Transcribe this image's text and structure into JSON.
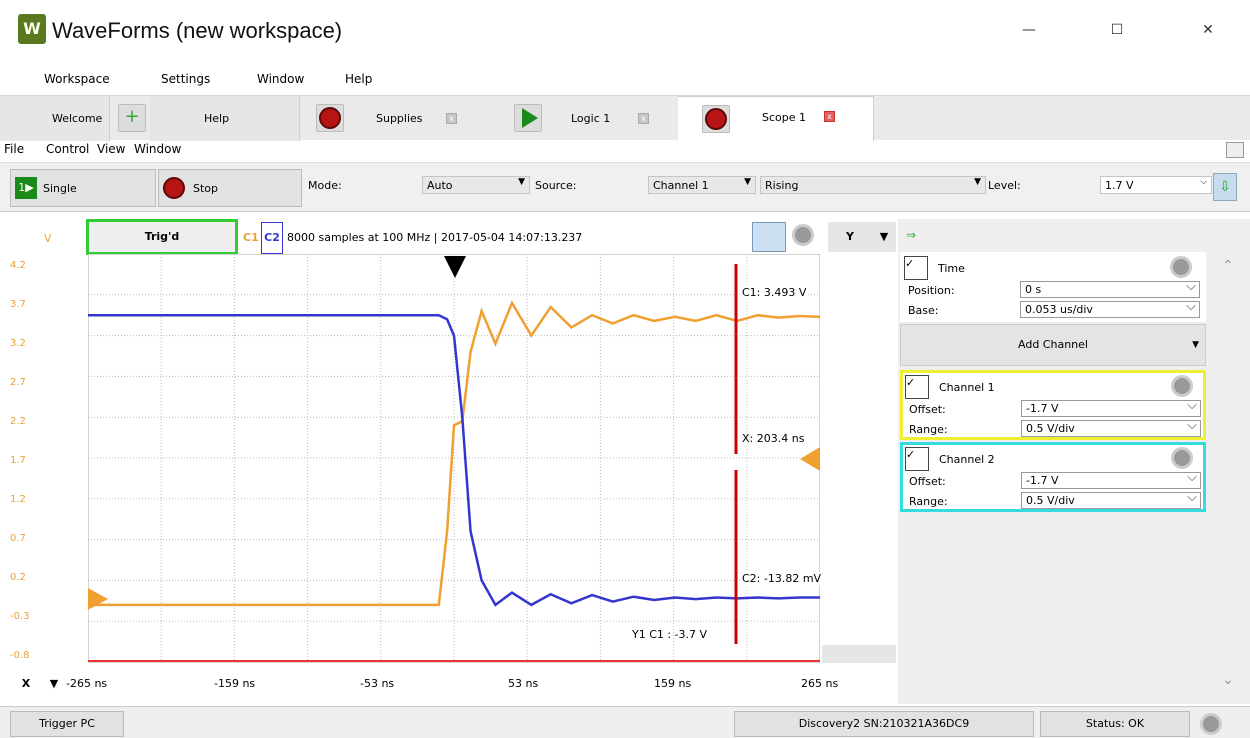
{
  "app": {
    "title": "WaveForms  (new workspace)"
  },
  "window_controls": {
    "minimize": "—",
    "maximize": "☐",
    "close": "✕"
  },
  "menu_main": [
    "Workspace",
    "Settings",
    "Window",
    "Help"
  ],
  "tabs": {
    "welcome": "Welcome",
    "help": "Help",
    "supplies": "Supplies",
    "logic": "Logic 1",
    "scope": "Scope 1"
  },
  "menu_scope": [
    "File",
    "Control",
    "View",
    "Window"
  ],
  "controls": {
    "single": "Single",
    "stop": "Stop",
    "mode_label": "Mode:",
    "mode_value": "Auto",
    "source_label": "Source:",
    "source_value": "Channel 1",
    "edge_value": "Rising",
    "level_label": "Level:",
    "level_value": "1.7 V"
  },
  "plot": {
    "v_label": "V",
    "trig_status": "Trig'd",
    "c1": "C1",
    "c2": "C2",
    "info": "8000 samples at 100 MHz | 2017-05-04 14:07:13.237",
    "y_button": "Y",
    "x_button": "X",
    "cursor_c1": "C1: 3.493 V",
    "cursor_x": "X: 203.4 ns",
    "cursor_c2": "C2: -13.82 mV",
    "y1_label": "Y1 C1 : -3.7 V",
    "y_ticks": [
      "4.2",
      "3.7",
      "3.2",
      "2.7",
      "2.2",
      "1.7",
      "1.2",
      "0.7",
      "0.2",
      "-0.3",
      "-0.8"
    ],
    "x_ticks": [
      "-265 ns",
      "-159 ns",
      "-53 ns",
      "53 ns",
      "159 ns",
      "265 ns"
    ]
  },
  "chart_data": {
    "type": "line",
    "x": [
      -265,
      -80,
      -11,
      -5,
      0,
      6,
      12,
      20,
      30,
      42,
      56,
      70,
      85,
      100,
      115,
      130,
      145,
      160,
      175,
      190,
      205,
      220,
      235,
      250,
      265
    ],
    "series": [
      {
        "name": "C1",
        "color": "#f0a030",
        "values": [
          -0.1,
          -0.1,
          -0.1,
          0.8,
          2.1,
          2.15,
          3.0,
          3.5,
          3.1,
          3.6,
          3.2,
          3.55,
          3.3,
          3.45,
          3.35,
          3.45,
          3.38,
          3.43,
          3.38,
          3.45,
          3.38,
          3.45,
          3.42,
          3.44,
          3.43
        ]
      },
      {
        "name": "C2",
        "color": "#3535d0",
        "values": [
          3.45,
          3.45,
          3.45,
          3.4,
          3.2,
          2.2,
          0.8,
          0.2,
          -0.1,
          0.05,
          -0.1,
          0.03,
          -0.08,
          0.02,
          -0.06,
          0.0,
          -0.04,
          -0.01,
          -0.03,
          -0.01,
          -0.02,
          -0.01,
          -0.02,
          -0.01,
          -0.01
        ]
      }
    ],
    "ylim": [
      -0.8,
      4.2
    ],
    "xlim": [
      -265,
      265
    ],
    "grid": true
  },
  "right_panel": {
    "time": "Time",
    "position_label": "Position:",
    "position_value": "0 s",
    "base_label": "Base:",
    "base_value": "0.053 us/div",
    "add_channel": "Add Channel",
    "ch1": "Channel 1",
    "ch2": "Channel 2",
    "offset_label": "Offset:",
    "range_label": "Range:",
    "ch1_offset": "-1.7 V",
    "ch1_range": "0.5 V/div",
    "ch2_offset": "-1.7 V",
    "ch2_range": "0.5 V/div"
  },
  "status": {
    "trigger_pc": "Trigger PC",
    "device": "Discovery2 SN:210321A36DC9",
    "status": "Status: OK"
  }
}
